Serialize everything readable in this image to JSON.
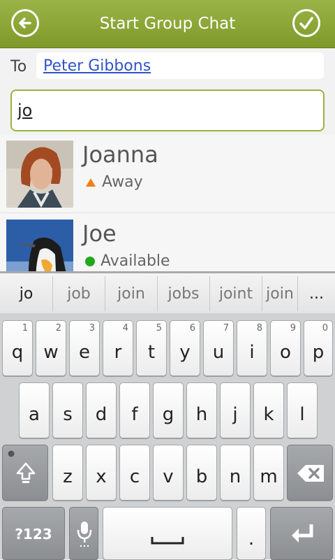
{
  "header": {
    "title": "Start Group Chat",
    "back_icon": "back-arrow-icon",
    "done_icon": "checkmark-icon"
  },
  "to": {
    "label": "To",
    "recipient": "Peter Gibbons"
  },
  "search": {
    "value": "jo"
  },
  "contacts": [
    {
      "name": "Joanna",
      "status": "Away",
      "status_color": "#f07f1a"
    },
    {
      "name": "Joe",
      "status": "Available",
      "status_color": "#22a81c"
    }
  ],
  "suggestions": [
    "jo",
    "job",
    "join",
    "jobs",
    "joint",
    "join",
    "..."
  ],
  "keyboard": {
    "row1": [
      {
        "k": "q",
        "n": "1"
      },
      {
        "k": "w",
        "n": "2"
      },
      {
        "k": "e",
        "n": "3"
      },
      {
        "k": "r",
        "n": "4"
      },
      {
        "k": "t",
        "n": "5"
      },
      {
        "k": "y",
        "n": "6"
      },
      {
        "k": "u",
        "n": "7"
      },
      {
        "k": "i",
        "n": "8"
      },
      {
        "k": "o",
        "n": "9"
      },
      {
        "k": "p",
        "n": "0"
      }
    ],
    "row2": [
      "a",
      "s",
      "d",
      "f",
      "g",
      "h",
      "j",
      "k",
      "l"
    ],
    "row3": [
      "z",
      "x",
      "c",
      "v",
      "b",
      "n",
      "m"
    ],
    "symbols_label": "?123",
    "period_label": "."
  },
  "colors": {
    "accent": "#8aa532",
    "link": "#3154c8"
  }
}
